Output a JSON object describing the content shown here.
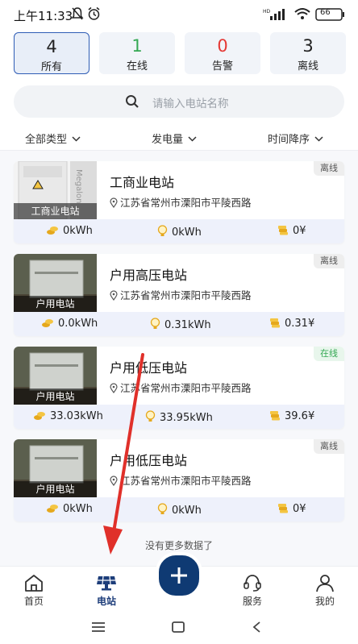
{
  "status_bar": {
    "time": "上午11:33",
    "battery": "66"
  },
  "tabs": [
    {
      "count": "4",
      "label": "所有",
      "color": "#222222"
    },
    {
      "count": "1",
      "label": "在线",
      "color": "#34a853"
    },
    {
      "count": "0",
      "label": "告警",
      "color": "#e53935"
    },
    {
      "count": "3",
      "label": "离线",
      "color": "#333333"
    }
  ],
  "search": {
    "placeholder": "请输入电站名称"
  },
  "filters": {
    "type": "全部类型",
    "metric": "发电量",
    "sort": "时间降序"
  },
  "stations": [
    {
      "name": "工商业电站",
      "thumb_label": "工商业电站",
      "address": "江苏省常州市溧阳市平陵西路",
      "status": "离线",
      "energy": "0kWh",
      "power": "0kWh",
      "income": "0¥"
    },
    {
      "name": "户用高压电站",
      "thumb_label": "户用电站",
      "address": "江苏省常州市溧阳市平陵西路",
      "status": "离线",
      "energy": "0.0kWh",
      "power": "0.31kWh",
      "income": "0.31¥"
    },
    {
      "name": "户用低压电站",
      "thumb_label": "户用电站",
      "address": "江苏省常州市溧阳市平陵西路",
      "status": "在线",
      "energy": "33.03kWh",
      "power": "33.95kWh",
      "income": "39.6¥"
    },
    {
      "name": "户用低压电站",
      "thumb_label": "户用电站",
      "address": "江苏省常州市溧阳市平陵西路",
      "status": "离线",
      "energy": "0kWh",
      "power": "0kWh",
      "income": "0¥"
    }
  ],
  "list_footer": "没有更多数据了",
  "tabbar": {
    "home": "首页",
    "station": "电站",
    "service": "服务",
    "mine": "我的"
  },
  "colors": {
    "accent": "#0f3a73",
    "online": "#34a853",
    "alarm": "#e53935",
    "annotation_arrow": "#e0302a"
  }
}
